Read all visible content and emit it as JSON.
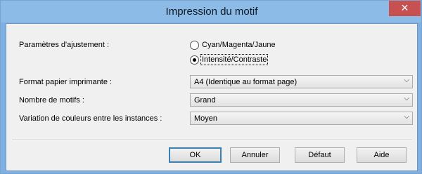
{
  "dialog": {
    "title": "Impression du motif",
    "close_glyph": "✕"
  },
  "adjustment": {
    "label": "Paramètres d'ajustement :",
    "options": [
      {
        "label": "Cyan/Magenta/Jaune",
        "checked": false
      },
      {
        "label": "Intensité/Contraste",
        "checked": true
      }
    ]
  },
  "fields": {
    "paper_format": {
      "label": "Format papier imprimante :",
      "value": "A4 (Identique au format page)"
    },
    "pattern_count": {
      "label": "Nombre de motifs :",
      "value": "Grand"
    },
    "color_variation": {
      "label": "Variation de couleurs entre les instances :",
      "value": "Moyen"
    }
  },
  "icons": {
    "dropdown": "chevron-down-icon"
  },
  "buttons": {
    "ok": "OK",
    "cancel": "Annuler",
    "default": "Défaut",
    "help": "Aide"
  },
  "colors": {
    "titlebar": "#8cbbe8",
    "close": "#c75050",
    "client": "#f0f0f0"
  }
}
